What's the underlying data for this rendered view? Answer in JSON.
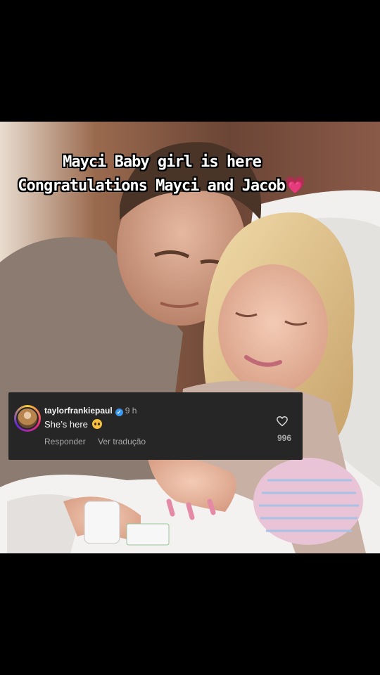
{
  "caption": {
    "line1": "Mayci Baby girl is here",
    "line2": "Congratulations Mayci and Jacob",
    "emoji": "💗"
  },
  "comment": {
    "username": "taylorfrankiepaul",
    "verified_mark": "✓",
    "time": "9 h",
    "text": "She’s here",
    "reply_label": "Responder",
    "translate_label": "Ver tradução",
    "like_count": "996"
  },
  "icons": {
    "heart": "heart-outline-icon",
    "verified": "verified-badge-icon",
    "emoji": "pleading-face-emoji"
  },
  "colors": {
    "comment_bg": "#262626",
    "verified_blue": "#3897f0",
    "caption_heart": "#ff3fa4"
  }
}
